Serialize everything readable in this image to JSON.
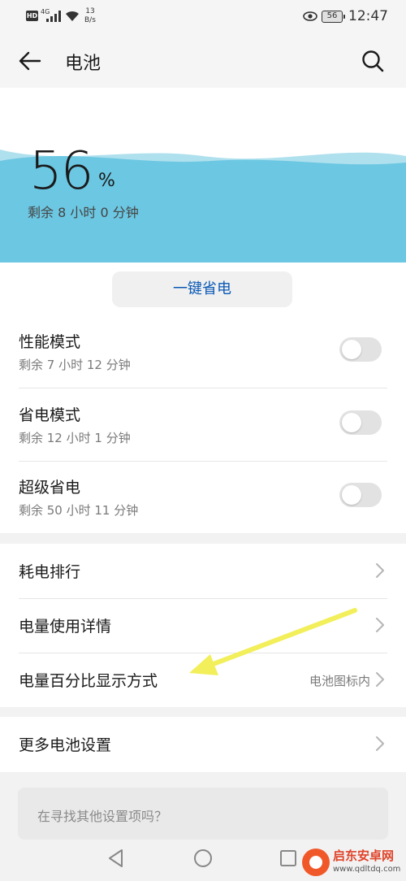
{
  "status_bar": {
    "hd": "HD",
    "network": "4G",
    "speed_value": "13",
    "speed_unit": "B/s",
    "battery": "56",
    "time": "12:47"
  },
  "header": {
    "title": "电池"
  },
  "battery": {
    "percent": "56",
    "unit": "%",
    "level": 0.56,
    "remaining": "剩余 8 小时 0 分钟"
  },
  "one_key_save": {
    "label": "一键省电"
  },
  "modes": [
    {
      "title": "性能模式",
      "subtitle": "剩余 7 小时 12 分钟",
      "enabled": false
    },
    {
      "title": "省电模式",
      "subtitle": "剩余 12 小时 1 分钟",
      "enabled": false
    },
    {
      "title": "超级省电",
      "subtitle": "剩余 50 小时 11 分钟",
      "enabled": false
    }
  ],
  "list": [
    {
      "title": "耗电排行",
      "value": ""
    },
    {
      "title": "电量使用详情",
      "value": ""
    },
    {
      "title": "电量百分比显示方式",
      "value": "电池图标内"
    }
  ],
  "more_settings": {
    "title": "更多电池设置"
  },
  "search_suggestion": {
    "text": "在寻找其他设置项吗？"
  },
  "watermark": {
    "name": "启东安卓网",
    "url": "www.qdltdq.com"
  },
  "colors": {
    "accent": "#0a59b5",
    "wave": "#6cc7e2",
    "annotation": "#f2ef5a"
  }
}
